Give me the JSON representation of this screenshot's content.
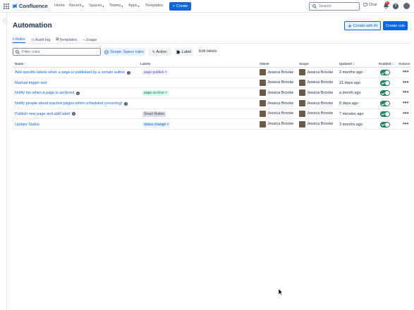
{
  "nav": {
    "app_name": "Confluence",
    "items": [
      {
        "label": "Home",
        "chevron": false
      },
      {
        "label": "Recent",
        "chevron": true
      },
      {
        "label": "Spaces",
        "chevron": true
      },
      {
        "label": "Teams",
        "chevron": true
      },
      {
        "label": "Apps",
        "chevron": true
      },
      {
        "label": "Templates",
        "chevron": false
      }
    ],
    "create_label": "Create",
    "search_placeholder": "Search",
    "chat_label": "Chat",
    "notification_count": "9+"
  },
  "page": {
    "title": "Automation",
    "create_with_ai_label": "Create with AI",
    "create_rule_label": "Create rule"
  },
  "tabs": [
    {
      "label": "Rules",
      "icon": "bolt-icon",
      "active": true
    },
    {
      "label": "Audit log",
      "icon": "clock-icon",
      "active": false
    },
    {
      "label": "Templates",
      "icon": "template-icon",
      "active": false
    },
    {
      "label": "Usage",
      "icon": "chart-icon",
      "active": false
    }
  ],
  "filters": {
    "search_placeholder": "Filter rules",
    "scope_label": "Scope: Space rules",
    "action_label": "Action",
    "label_label": "Label",
    "edit_labels": "Edit labels"
  },
  "table": {
    "columns": {
      "name": "Name ↑",
      "labels": "Labels",
      "owner": "Owner",
      "scope": "Scope",
      "updated": "Updated ↕",
      "enabled": "Enabled ↕",
      "actions": "Actions"
    },
    "rows": [
      {
        "name": "Add specific labels when a page is published by a certain author",
        "info": true,
        "label": "page publish ×",
        "label_color": "purple",
        "owner": "Jessica Brooke",
        "scope": "Jessica Brooke",
        "updated": "2 months ago",
        "enabled": true
      },
      {
        "name": "Manual trigger test",
        "info": false,
        "label": "",
        "label_color": "",
        "owner": "Jessica Brooke",
        "scope": "Jessica Brooke",
        "updated": "21 days ago",
        "enabled": true
      },
      {
        "name": "Notify me when a page is archived",
        "info": true,
        "label": "page archive ×",
        "label_color": "green",
        "owner": "Jessica Brooke",
        "scope": "Jessica Brooke",
        "updated": "a month ago",
        "enabled": true
      },
      {
        "name": "Notify people about inactive pages when scheduled (recurring)",
        "info": true,
        "label": "",
        "label_color": "",
        "owner": "Jessica Brooke",
        "scope": "Jessica Brooke",
        "updated": "8 days ago",
        "enabled": true
      },
      {
        "name": "Publish new page and add label",
        "info": true,
        "label": "Smart Button",
        "label_color": "gray",
        "owner": "Jessica Brooke",
        "scope": "Jessica Brooke",
        "updated": "7 minutes ago",
        "enabled": true
      },
      {
        "name": "Update Status",
        "info": false,
        "label": "status change ×",
        "label_color": "blue",
        "owner": "Jessica Brooke",
        "scope": "Jessica Brooke",
        "updated": "3 months ago",
        "enabled": true
      }
    ]
  },
  "colors": {
    "primary": "#0c66e4",
    "toggle_on": "#1f845a",
    "text": "#172b4d"
  }
}
